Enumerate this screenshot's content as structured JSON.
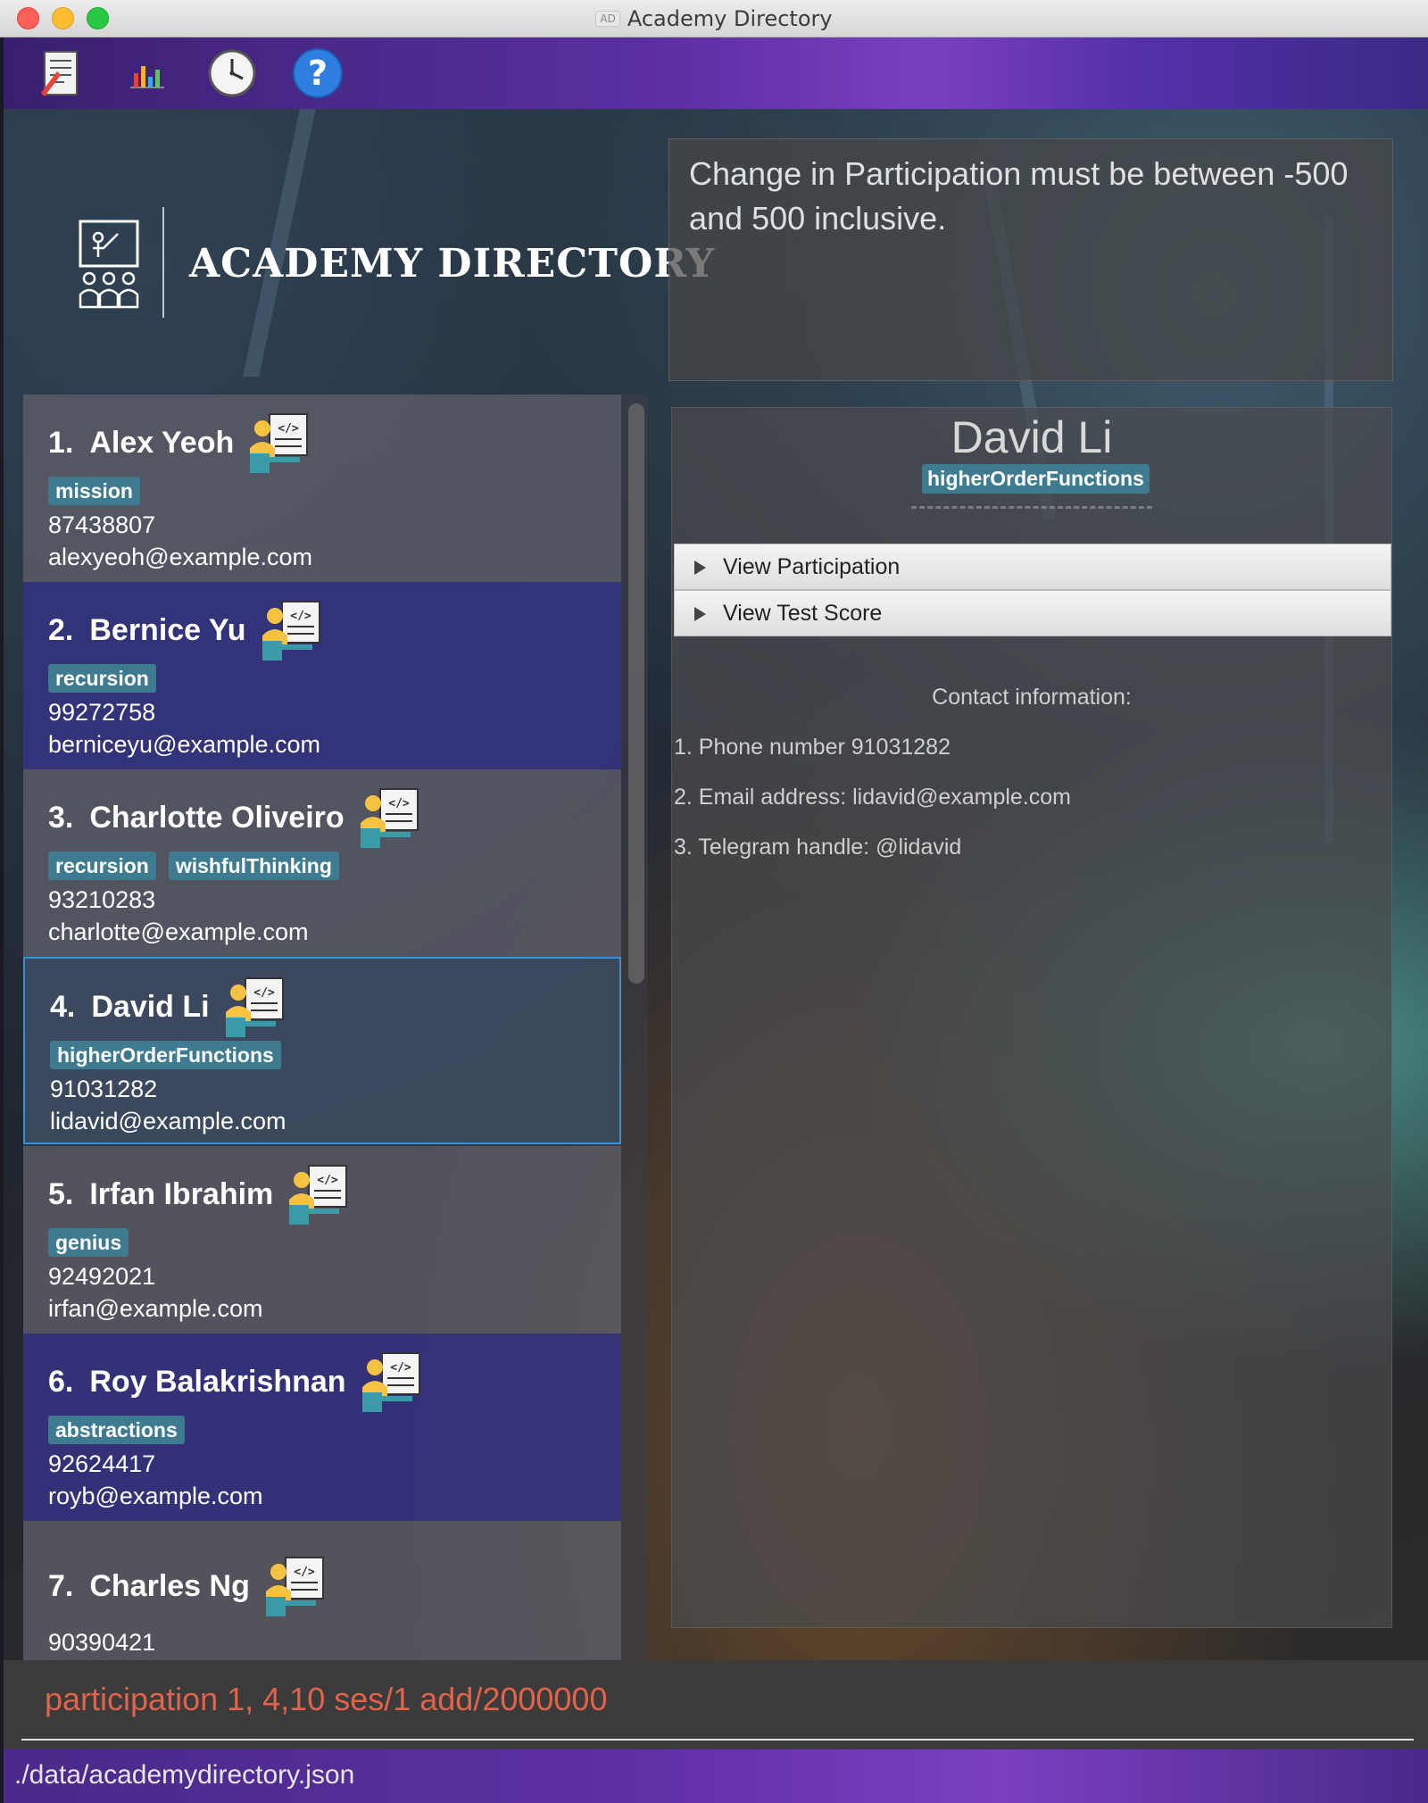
{
  "window": {
    "title": "Academy Directory",
    "title_icon": "AD"
  },
  "toolbar": {
    "buttons": [
      {
        "icon": "document-icon"
      },
      {
        "icon": "chart-icon"
      },
      {
        "icon": "clock-icon"
      },
      {
        "icon": "help-icon"
      }
    ]
  },
  "header": {
    "logo_text": "ACADEMY DIRECTORY"
  },
  "result": {
    "message": "Change in Participation must be between -500 and 500 inclusive."
  },
  "students": [
    {
      "index": "1.",
      "name": "Alex Yeoh",
      "tags": [
        "mission"
      ],
      "phone": "87438807",
      "email": "alexyeoh@example.com"
    },
    {
      "index": "2.",
      "name": "Bernice Yu",
      "tags": [
        "recursion"
      ],
      "phone": "99272758",
      "email": "berniceyu@example.com"
    },
    {
      "index": "3.",
      "name": "Charlotte Oliveiro",
      "tags": [
        "recursion",
        "wishfulThinking"
      ],
      "phone": "93210283",
      "email": "charlotte@example.com"
    },
    {
      "index": "4.",
      "name": "David Li",
      "tags": [
        "higherOrderFunctions"
      ],
      "phone": "91031282",
      "email": "lidavid@example.com"
    },
    {
      "index": "5.",
      "name": "Irfan Ibrahim",
      "tags": [
        "genius"
      ],
      "phone": "92492021",
      "email": "irfan@example.com"
    },
    {
      "index": "6.",
      "name": "Roy Balakrishnan",
      "tags": [
        "abstractions"
      ],
      "phone": "92624417",
      "email": "royb@example.com"
    },
    {
      "index": "7.",
      "name": "Charles Ng",
      "tags": [],
      "phone": "90390421",
      "email": ""
    }
  ],
  "detail": {
    "name": "David Li",
    "tag": "higherOrderFunctions",
    "accordion": [
      "View Participation",
      "View Test Score"
    ],
    "contact_title": "Contact information:",
    "contact_lines": [
      "1. Phone number 91031282",
      "2. Email address: lidavid@example.com",
      "3. Telegram handle: @lidavid"
    ]
  },
  "command": {
    "value": "participation 1, 4,10 ses/1 add/2000000"
  },
  "status": {
    "path": "./data/academydirectory.json"
  },
  "colors": {
    "tag": "#3e7b91",
    "selected_border": "#3d8fd0",
    "command_text": "#e0634a"
  }
}
